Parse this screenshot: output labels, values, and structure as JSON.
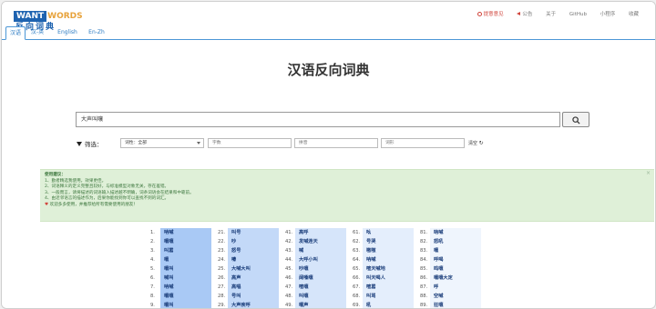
{
  "logo": {
    "box_text": "WANT",
    "words_text": "WORDS",
    "sub_text": "反向词典"
  },
  "topnav": [
    "提意意见",
    "公告",
    "关于",
    "GitHub",
    "小程序",
    "收藏"
  ],
  "tabs": [
    "汉语",
    "汉-英",
    "English",
    "En-Zh"
  ],
  "title": "汉语反向词典",
  "search": {
    "value": "大声叫嚷"
  },
  "filter": {
    "label": "筛选：",
    "pos_select": "词性：全部",
    "placeholders": [
      "字数",
      "拼音",
      "词形"
    ],
    "clear_label": "清空"
  },
  "tips": {
    "head": "使用建议：",
    "lines": [
      "1、勤者精选我使用，效果更佳。",
      "2、词语释义的定义完整且较好，与标准模型对象无关，存在差错。",
      "3、一般而言，请将描述的词语输入描述越不明确，词条词语会在结果和中靠前。",
      "4、由近邻语言的描述作为，后果你能找到你可以查找不到的词汇。",
      "欢迎多多使用，并推荐给所有需要使用的朋友！"
    ]
  },
  "colors": {
    "accent": "#2a7ac2",
    "tip_bg": "#dff0d8",
    "tip_text": "#3c763d",
    "hot": "#d0443b"
  },
  "results": [
    {
      "nums": [
        "1.",
        "2.",
        "3.",
        "4.",
        "5.",
        "6.",
        "7.",
        "8.",
        "9."
      ],
      "words": [
        "呐喊",
        "嚷嚷",
        "叫嚣",
        "嚷",
        "嚷叫",
        "喊叫",
        "呐喊",
        "嚷嚷",
        "嚷叫"
      ],
      "bg": "#a9c9f5"
    },
    {
      "nums": [
        "21.",
        "22.",
        "23.",
        "24.",
        "25.",
        "26.",
        "27.",
        "28.",
        "29."
      ],
      "words": [
        "叫号",
        "吵",
        "怒号",
        "嚎",
        "大喊大叫",
        "高声",
        "高唱",
        "号叫",
        "大声疾呼"
      ],
      "bg": "#c3d9f8"
    },
    {
      "nums": [
        "41.",
        "42.",
        "43.",
        "44.",
        "45.",
        "46.",
        "47.",
        "48.",
        "49."
      ],
      "words": [
        "高呼",
        "发喊连天",
        "喊",
        "大呼小叫",
        "吵嚷",
        "阔嗓嚷",
        "喧嚷",
        "叫嚷",
        "嚷声"
      ],
      "bg": "#d6e5fa"
    },
    {
      "nums": [
        "61.",
        "62.",
        "63.",
        "64.",
        "65.",
        "66.",
        "67.",
        "68.",
        "69."
      ],
      "words": [
        "吆",
        "号哭",
        "嗷嗷",
        "呐喊",
        "喧天喊地",
        "叫天喝人",
        "喧嚣",
        "叫骂",
        "吼"
      ],
      "bg": "#e4eefc"
    },
    {
      "nums": [
        "81.",
        "82.",
        "83.",
        "84.",
        "85.",
        "86.",
        "87.",
        "88.",
        "89."
      ],
      "words": [
        "吶喊",
        "怒吼",
        "嚷",
        "呼喝",
        "鸣嚷",
        "嚷嚷大定",
        "呼",
        "空喊",
        "狂嚷"
      ],
      "bg": "#eff5fd"
    }
  ]
}
